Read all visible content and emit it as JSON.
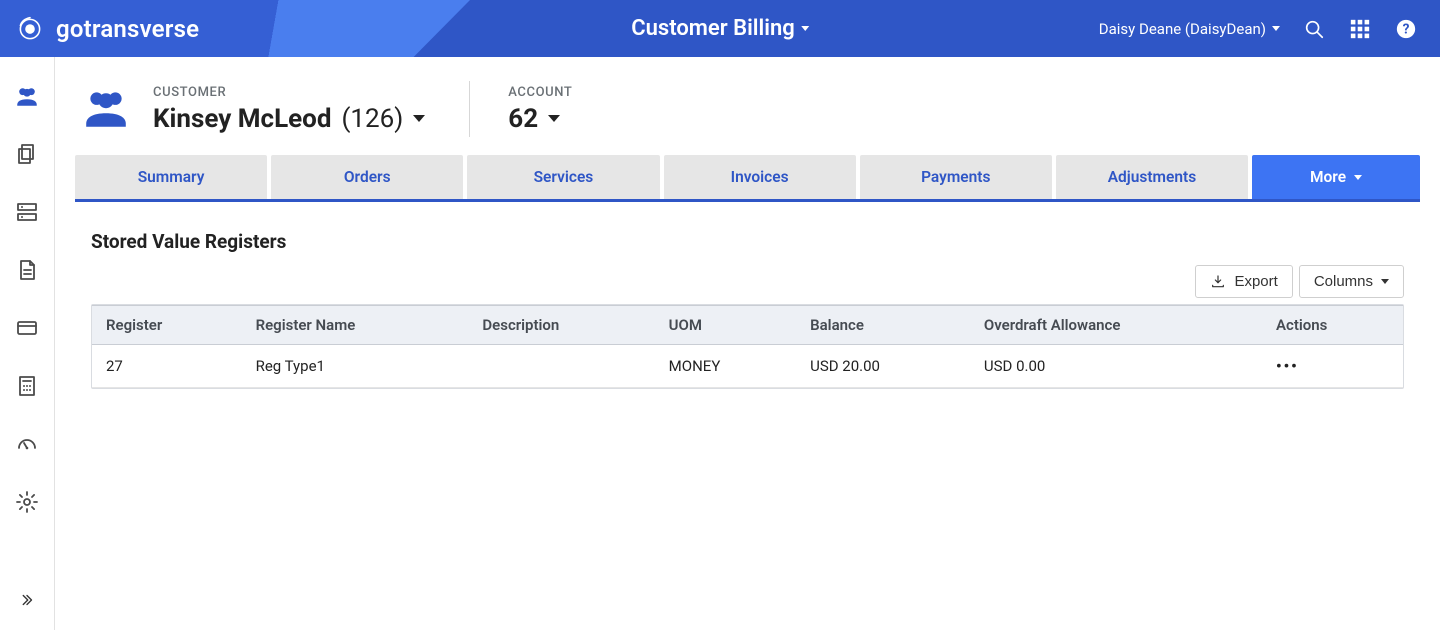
{
  "header": {
    "brand": "gotransverse",
    "center_title": "Customer Billing",
    "user_display": "Daisy Deane (DaisyDean)"
  },
  "customer": {
    "eyebrow": "CUSTOMER",
    "name": "Kinsey McLeod",
    "paren": "(126)"
  },
  "account": {
    "eyebrow": "ACCOUNT",
    "value": "62"
  },
  "tabs": {
    "items": [
      "Summary",
      "Orders",
      "Services",
      "Invoices",
      "Payments",
      "Adjustments"
    ],
    "more_label": "More"
  },
  "section": {
    "title": "Stored Value Registers",
    "export_label": "Export",
    "columns_label": "Columns"
  },
  "table": {
    "columns": [
      "Register",
      "Register Name",
      "Description",
      "UOM",
      "Balance",
      "Overdraft Allowance",
      "Actions"
    ],
    "rows": [
      {
        "register": "27",
        "name": "Reg Type1",
        "description": "",
        "uom": "MONEY",
        "balance": "USD 20.00",
        "overdraft": "USD 0.00"
      }
    ]
  }
}
